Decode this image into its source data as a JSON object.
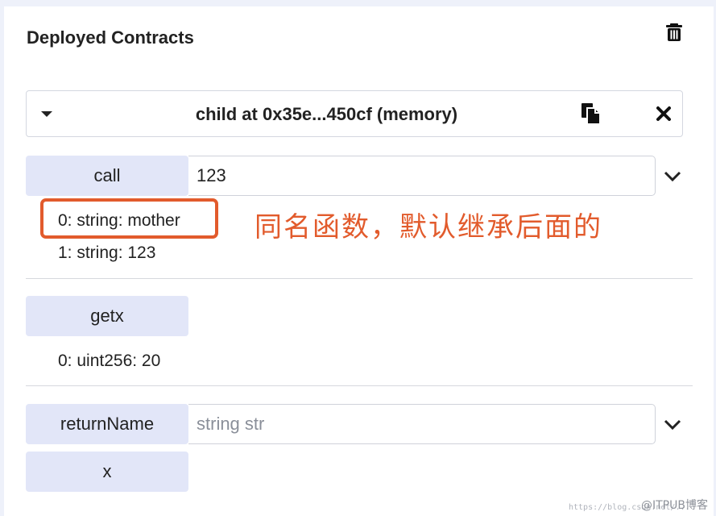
{
  "header": {
    "title": "Deployed Contracts"
  },
  "instance": {
    "title": "child at 0x35e...450cf (memory)"
  },
  "functions": {
    "call": {
      "label": "call",
      "input_value": "123",
      "outputs": [
        "0: string: mother",
        "1: string: 123"
      ]
    },
    "getx": {
      "label": "getx",
      "outputs": [
        "0: uint256: 20"
      ]
    },
    "returnName": {
      "label": "returnName",
      "placeholder": "string str"
    },
    "x": {
      "label": "x"
    }
  },
  "annotation": {
    "text": "同名函数，默认继承后面的",
    "color": "#e25b2c"
  },
  "watermark": {
    "url": "https://blog.csdn.net/...",
    "brand": "@ITPUB博客"
  },
  "colors": {
    "button_bg": "#e2e6f8",
    "accent": "#e25b2c"
  },
  "icons": [
    "trash-icon",
    "caret-down-icon",
    "copy-icon",
    "close-icon",
    "chevron-down-icon"
  ]
}
